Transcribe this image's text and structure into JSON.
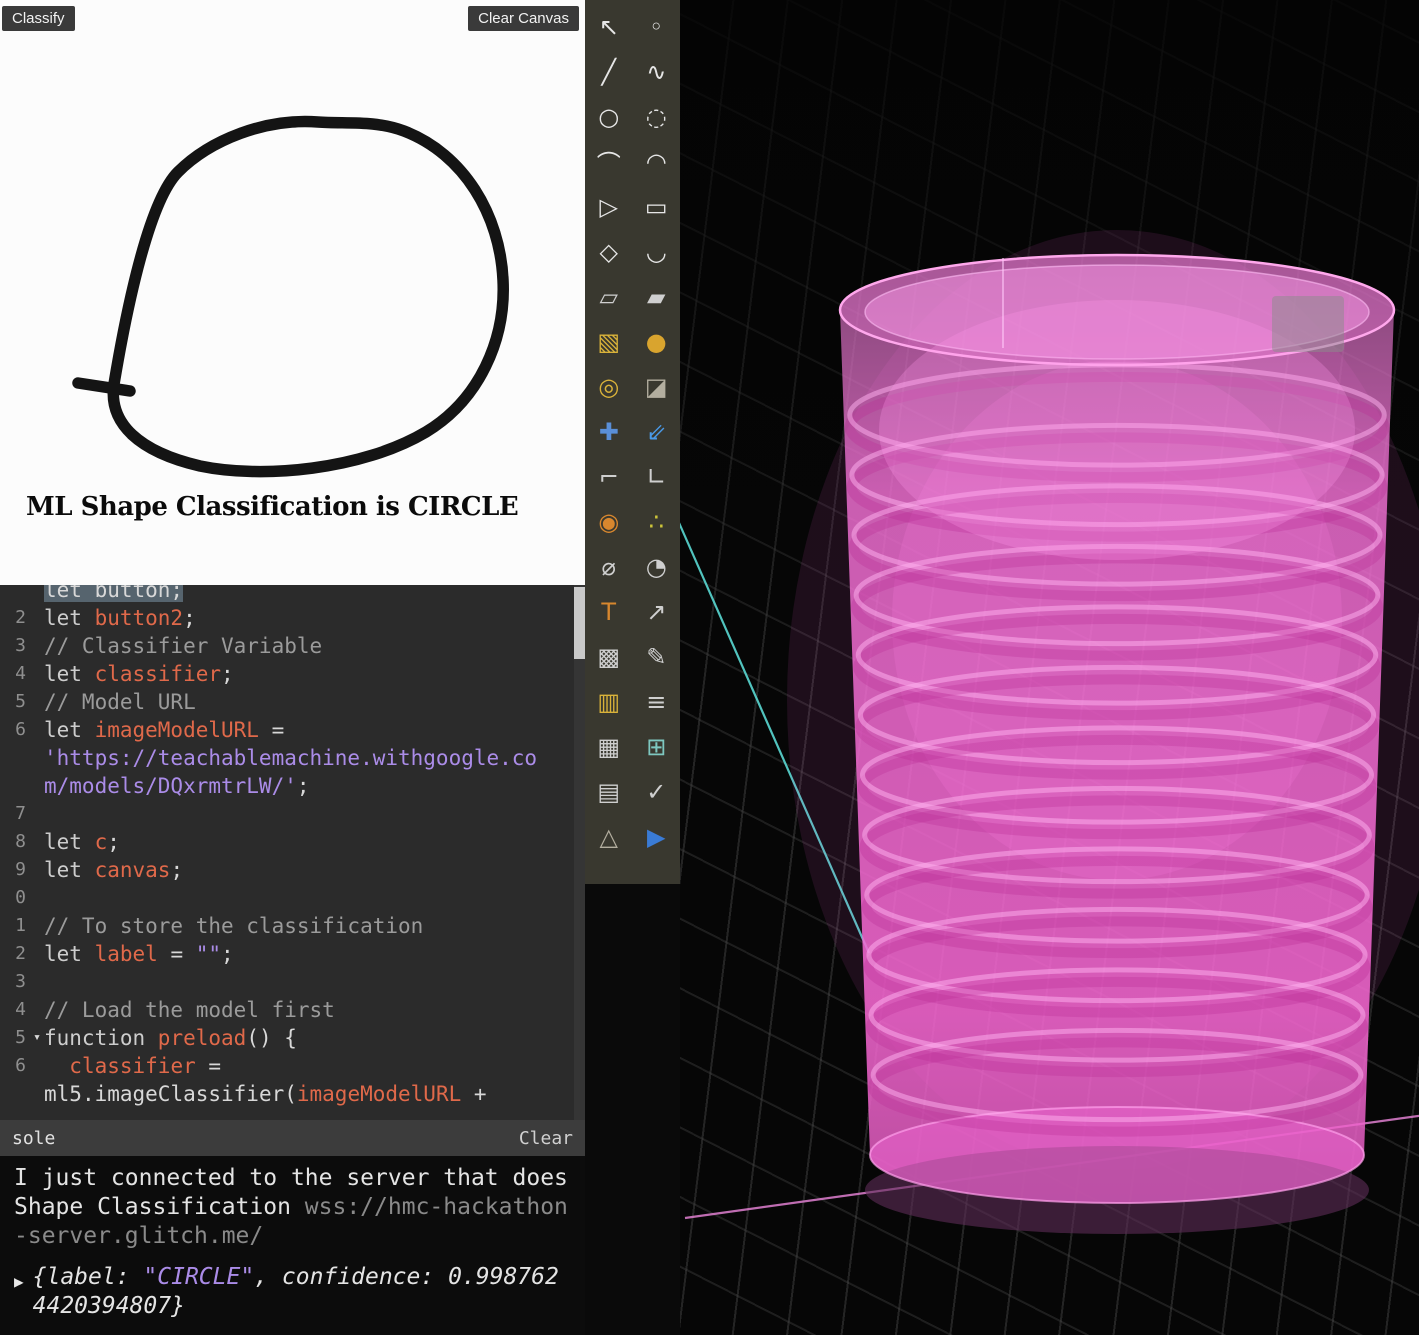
{
  "sketch_panel": {
    "classify_label": "Classify",
    "clear_canvas_label": "Clear Canvas",
    "result_text": "ML Shape Classification is CIRCLE"
  },
  "editor": {
    "lines": [
      {
        "num": "",
        "sel": true,
        "tokens": [
          {
            "t": "let button;",
            "c": "pl"
          }
        ]
      },
      {
        "num": "2",
        "tokens": [
          {
            "t": "let ",
            "c": "kw"
          },
          {
            "t": "button2",
            "c": "id"
          },
          {
            "t": ";",
            "c": "pl"
          }
        ]
      },
      {
        "num": "3",
        "tokens": [
          {
            "t": "// Classifier Variable",
            "c": "cm"
          }
        ]
      },
      {
        "num": "4",
        "tokens": [
          {
            "t": "let ",
            "c": "kw"
          },
          {
            "t": "classifier",
            "c": "id"
          },
          {
            "t": ";",
            "c": "pl"
          }
        ]
      },
      {
        "num": "5",
        "tokens": [
          {
            "t": "// Model URL",
            "c": "cm"
          }
        ]
      },
      {
        "num": "6",
        "tokens": [
          {
            "t": "let ",
            "c": "kw"
          },
          {
            "t": "imageModelURL",
            "c": "id"
          },
          {
            "t": " =",
            "c": "pl"
          }
        ]
      },
      {
        "num": "",
        "tokens": [
          {
            "t": "'https://teachablemachine.withgoogle.co",
            "c": "str"
          }
        ]
      },
      {
        "num": "",
        "tokens": [
          {
            "t": "m/models/DQxrmtrLW/'",
            "c": "str"
          },
          {
            "t": ";",
            "c": "pl"
          }
        ]
      },
      {
        "num": "7",
        "tokens": []
      },
      {
        "num": "8",
        "tokens": [
          {
            "t": "let ",
            "c": "kw"
          },
          {
            "t": "c",
            "c": "id"
          },
          {
            "t": ";",
            "c": "pl"
          }
        ]
      },
      {
        "num": "9",
        "tokens": [
          {
            "t": "let ",
            "c": "kw"
          },
          {
            "t": "canvas",
            "c": "id"
          },
          {
            "t": ";",
            "c": "pl"
          }
        ]
      },
      {
        "num": "0",
        "tokens": []
      },
      {
        "num": "1",
        "tokens": [
          {
            "t": "// To store the classification",
            "c": "cm"
          }
        ]
      },
      {
        "num": "2",
        "tokens": [
          {
            "t": "let ",
            "c": "kw"
          },
          {
            "t": "label",
            "c": "id"
          },
          {
            "t": " = ",
            "c": "pl"
          },
          {
            "t": "\"\"",
            "c": "str"
          },
          {
            "t": ";",
            "c": "pl"
          }
        ]
      },
      {
        "num": "3",
        "tokens": []
      },
      {
        "num": "4",
        "tokens": [
          {
            "t": "// Load the model first",
            "c": "cm"
          }
        ]
      },
      {
        "num": "5",
        "fold": true,
        "tokens": [
          {
            "t": "function ",
            "c": "kw"
          },
          {
            "t": "preload",
            "c": "id"
          },
          {
            "t": "() {",
            "c": "pl"
          }
        ]
      },
      {
        "num": "6",
        "tokens": [
          {
            "t": "  ",
            "c": "pl"
          },
          {
            "t": "classifier",
            "c": "id"
          },
          {
            "t": " =",
            "c": "pl"
          }
        ]
      },
      {
        "num": "",
        "tokens": [
          {
            "t": "ml5",
            "c": "pl"
          },
          {
            "t": ".imageClassifier(",
            "c": "pl"
          },
          {
            "t": "imageModelURL",
            "c": "id"
          },
          {
            "t": " +",
            "c": "pl"
          }
        ]
      }
    ]
  },
  "console": {
    "title": "sole",
    "clear_label": "Clear",
    "expander": "▶",
    "message_main": "I just connected to the server that does Shape Classification ",
    "message_url": "wss://hmc-hackathon-server.glitch.me/",
    "result_prefix": "{label: ",
    "result_label": "\"CIRCLE\"",
    "result_suffix": ", confidence: 0.9987624420394807}"
  },
  "toolbar": {
    "icons": [
      {
        "name": "select-arrow-icon",
        "glyph": "↖",
        "color": "#e6e6e6"
      },
      {
        "name": "point-icon",
        "glyph": "◦",
        "color": "#e6e6e6"
      },
      {
        "name": "polyline-icon",
        "glyph": "╱",
        "color": "#e6e6e6"
      },
      {
        "name": "curve-icon",
        "glyph": "∿",
        "color": "#e6e6e6"
      },
      {
        "name": "circle-icon",
        "glyph": "○",
        "color": "#e6e6e6"
      },
      {
        "name": "circle-points-icon",
        "glyph": "◌",
        "color": "#e6e6e6"
      },
      {
        "name": "arc-icon",
        "glyph": "⌒",
        "color": "#e6e6e6"
      },
      {
        "name": "arc-points-icon",
        "glyph": "◠",
        "color": "#e6e6e6"
      },
      {
        "name": "closed-polyline-icon",
        "glyph": "▷",
        "color": "#e6e6e6"
      },
      {
        "name": "rectangle-icon",
        "glyph": "▭",
        "color": "#e6e6e6"
      },
      {
        "name": "polygon-icon",
        "glyph": "◇",
        "color": "#e6e6e6"
      },
      {
        "name": "fillet-icon",
        "glyph": "◡",
        "color": "#e6e6e6"
      },
      {
        "name": "surface-icon",
        "glyph": "▱",
        "color": "#cfcfcf"
      },
      {
        "name": "surface-corner-icon",
        "glyph": "▰",
        "color": "#cfcfcf"
      },
      {
        "name": "box-icon",
        "glyph": "▧",
        "color": "#d9b23a"
      },
      {
        "name": "sphere-icon",
        "glyph": "●",
        "color": "#d9a42e"
      },
      {
        "name": "cylinder-icon",
        "glyph": "◎",
        "color": "#d9b23a"
      },
      {
        "name": "shaded-surface-icon",
        "glyph": "◪",
        "color": "#b3ae9f"
      },
      {
        "name": "plugin-icon",
        "glyph": "✚",
        "color": "#5a8fd8"
      },
      {
        "name": "move-arrow-icon",
        "glyph": "⇙",
        "color": "#4a9ae8"
      },
      {
        "name": "bend-icon",
        "glyph": "⌐",
        "color": "#cfcfcf"
      },
      {
        "name": "angle-icon",
        "glyph": "∟",
        "color": "#cfcfcf"
      },
      {
        "name": "blend-icon",
        "glyph": "◉",
        "color": "#d8872e"
      },
      {
        "name": "scatter-points-icon",
        "glyph": "∴",
        "color": "#cdc53a"
      },
      {
        "name": "diameter-icon",
        "glyph": "⌀",
        "color": "#cfcfcf"
      },
      {
        "name": "protractor-icon",
        "glyph": "◔",
        "color": "#cfcfcf"
      },
      {
        "name": "text-icon",
        "glyph": "T",
        "color": "#d8872e"
      },
      {
        "name": "leader-icon",
        "glyph": "↗",
        "color": "#cfcfcf"
      },
      {
        "name": "hatch-icon",
        "glyph": "▩",
        "color": "#cfcfcf"
      },
      {
        "name": "draft-icon",
        "glyph": "✎",
        "color": "#cfcfcf"
      },
      {
        "name": "block-icon",
        "glyph": "▥",
        "color": "#d9b23a"
      },
      {
        "name": "histogram-icon",
        "glyph": "≡",
        "color": "#cfcfcf"
      },
      {
        "name": "grid-icon",
        "glyph": "▦",
        "color": "#cfcfcf"
      },
      {
        "name": "clipping-plane-icon",
        "glyph": "⊞",
        "color": "#7ec8c0"
      },
      {
        "name": "notebook-icon",
        "glyph": "▤",
        "color": "#cfcfcf"
      },
      {
        "name": "check-icon",
        "glyph": "✓",
        "color": "#cfcfcf"
      },
      {
        "name": "prism-icon",
        "glyph": "△",
        "color": "#b3ae9f"
      },
      {
        "name": "play-icon",
        "glyph": "▶",
        "color": "#3a7bd5"
      }
    ]
  },
  "viewport": {
    "object": "pink-translucent-cylinder",
    "colors": {
      "cylinder": "#fb76df",
      "cyan_line": "#5ad8d2",
      "pink_line": "#e07fd0",
      "background": "#060606"
    }
  }
}
